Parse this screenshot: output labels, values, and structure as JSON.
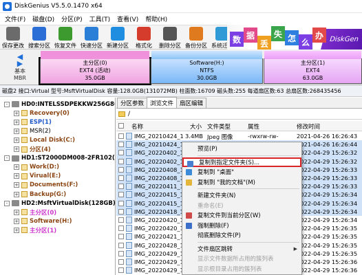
{
  "window": {
    "title": "DiskGenius V5.5.0.1470 x64"
  },
  "menu": [
    "文件(F)",
    "磁盘(D)",
    "分区(P)",
    "工具(T)",
    "查看(V)",
    "帮助(H)"
  ],
  "toolbar": [
    {
      "label": "保存更改",
      "icon": "save-icon",
      "color": "#6b6b6b"
    },
    {
      "label": "搜索分区",
      "icon": "search-icon",
      "color": "#2b6fd6"
    },
    {
      "label": "恢复文件",
      "icon": "restore-icon",
      "color": "#3c9a2f"
    },
    {
      "label": "快速分区",
      "icon": "quick-partition-icon",
      "color": "#2b7fd6"
    },
    {
      "label": "新建分区",
      "icon": "new-partition-icon",
      "color": "#1f8ee0"
    },
    {
      "label": "格式化",
      "icon": "format-icon",
      "color": "#d63c2b"
    },
    {
      "label": "删除分区",
      "icon": "delete-icon",
      "color": "#555555"
    },
    {
      "label": "备份分区",
      "icon": "backup-icon",
      "color": "#e07a1f"
    },
    {
      "label": "系统迁移",
      "icon": "migrate-icon",
      "color": "#2f9ad6"
    }
  ],
  "banner": {
    "chars": [
      {
        "t": "数",
        "c": "#7b3fe4"
      },
      {
        "t": "据",
        "c": "#e24a8a"
      },
      {
        "t": "丢",
        "c": "#f0a020"
      },
      {
        "t": "失",
        "c": "#3aa54a"
      },
      {
        "t": "怎",
        "c": "#2f7fe0"
      },
      {
        "t": "么",
        "c": "#7b3fe4"
      },
      {
        "t": "办",
        "c": "#e24a4a"
      }
    ],
    "brand": "DiskGen"
  },
  "diskmap": {
    "basic_line1": "基本",
    "basic_line2": "MBR",
    "partitions": [
      {
        "title": "主分区(0)",
        "fs": "EXT4 (活动)",
        "size": "35.0GB"
      },
      {
        "title": "Software(H:)",
        "fs": "NTFS",
        "size": "30.0GB"
      },
      {
        "title": "主分区(1)",
        "fs": "EXT4",
        "size": "63.0GB"
      }
    ]
  },
  "infobar": "磁盘2 接口:Virtual  型号:MsftVirtualDisk  容量:128.0GB(131072MB)  柱面数:16709  磁头数:255  每道扇区数:63  总扇区数:268435456",
  "tree": [
    {
      "label": "HD0:INTELSSDPEKKW256G8(238",
      "style": "b",
      "kind": "disk",
      "toggle": "-",
      "indent": 0
    },
    {
      "label": "Recovery(0)",
      "style": "brown",
      "kind": "part",
      "toggle": "+",
      "indent": 1
    },
    {
      "label": "ESP(1)",
      "style": "blue",
      "kind": "part",
      "toggle": "+",
      "indent": 1
    },
    {
      "label": "MSR(2)",
      "style": "",
      "kind": "part",
      "toggle": "+",
      "indent": 1
    },
    {
      "label": "Local Disk(C:)",
      "style": "brown",
      "kind": "part",
      "toggle": "+",
      "indent": 1
    },
    {
      "label": "分区(4)",
      "style": "brown",
      "kind": "part",
      "toggle": "+",
      "indent": 1
    },
    {
      "label": "HD1:ST2000DM008-2FR102(1863",
      "style": "b",
      "kind": "disk",
      "toggle": "-",
      "indent": 0
    },
    {
      "label": "Work(D:)",
      "style": "brown",
      "kind": "part",
      "toggle": "+",
      "indent": 1
    },
    {
      "label": "Virual(E:)",
      "style": "brown",
      "kind": "part",
      "toggle": "+",
      "indent": 1
    },
    {
      "label": "Documents(F:)",
      "style": "brown",
      "kind": "part",
      "toggle": "+",
      "indent": 1
    },
    {
      "label": "Backup(G:)",
      "style": "brown",
      "kind": "part",
      "toggle": "+",
      "indent": 1
    },
    {
      "label": "HD2:MsftVirtualDisk(128GB)",
      "style": "b",
      "kind": "disk",
      "toggle": "-",
      "indent": 0
    },
    {
      "label": "主分区(0)",
      "style": "pink",
      "kind": "part",
      "toggle": "+",
      "indent": 1
    },
    {
      "label": "Software(H:)",
      "style": "brown",
      "kind": "part",
      "toggle": "+",
      "indent": 1
    },
    {
      "label": "主分区(1)",
      "style": "pink",
      "kind": "part",
      "toggle": "+",
      "indent": 1
    }
  ],
  "tabs": [
    "分区参数",
    "浏览文件",
    "扇区编辑"
  ],
  "active_tab": 1,
  "path": "/",
  "columns": {
    "name": "名称",
    "size": "大小",
    "type": "文件类型",
    "attr": "属性",
    "mod": "修改时间"
  },
  "files": [
    {
      "name": "IMG_20210424_1",
      "size": "3.4MB",
      "type": "Jpeg 图像",
      "attr": "-rwxrw-rw-",
      "mod": "2021-04-26 16:26:43",
      "sel": false
    },
    {
      "name": "IMG_20210424_1",
      "size": "",
      "type": "",
      "attr": "",
      "mod": "2021-04-26 16:26:44",
      "sel": true
    },
    {
      "name": "IMG_20220402_1",
      "size": "",
      "type": "",
      "attr": "",
      "mod": "2022-04-29 15:26:32",
      "sel": true
    },
    {
      "name": "IMG_20220402_1",
      "size": "",
      "type": "",
      "attr": "",
      "mod": "2022-04-29 15:26:32",
      "sel": true
    },
    {
      "name": "IMG_20220408_1",
      "size": "",
      "type": "",
      "attr": "",
      "mod": "2022-04-29 15:26:33",
      "sel": true
    },
    {
      "name": "IMG_20220408_1",
      "size": "",
      "type": "",
      "attr": "",
      "mod": "2022-04-29 15:26:33",
      "sel": true
    },
    {
      "name": "IMG_20220411_1",
      "size": "",
      "type": "",
      "attr": "",
      "mod": "2022-04-29 15:26:33",
      "sel": true
    },
    {
      "name": "IMG_20220415_1",
      "size": "",
      "type": "",
      "attr": "",
      "mod": "2022-04-29 15:26:34",
      "sel": true
    },
    {
      "name": "IMG_20220415_1",
      "size": "",
      "type": "",
      "attr": "",
      "mod": "2022-04-29 15:26:34",
      "sel": true
    },
    {
      "name": "IMG_20220418_1",
      "size": "",
      "type": "",
      "attr": "",
      "mod": "2022-04-29 15:26:34",
      "sel": true
    },
    {
      "name": "IMG_20220420_1",
      "size": "",
      "type": "",
      "attr": "",
      "mod": "2022-04-29 15:26:34",
      "sel": false
    },
    {
      "name": "IMG_20220420_1",
      "size": "",
      "type": "",
      "attr": "",
      "mod": "2022-04-29 15:26:35",
      "sel": false
    },
    {
      "name": "IMG_20220421_1",
      "size": "",
      "type": "",
      "attr": "",
      "mod": "2022-04-29 15:26:35",
      "sel": false
    },
    {
      "name": "IMG_20220428_1",
      "size": "",
      "type": "",
      "attr": "",
      "mod": "2022-04-29 15:26:35",
      "sel": false
    },
    {
      "name": "IMG_20220429_1",
      "size": "",
      "type": "",
      "attr": "",
      "mod": "2022-04-29 15:26:35",
      "sel": false
    },
    {
      "name": "IMG_20220429_1",
      "size": "",
      "type": "",
      "attr": "",
      "mod": "2022-04-29 15:26:36",
      "sel": false
    },
    {
      "name": "IMG_20220429_1",
      "size": "",
      "type": "",
      "attr": "",
      "mod": "2022-04-29 15:26:36",
      "sel": false
    }
  ],
  "context_menu": [
    {
      "label": "预览(P)",
      "icon": "",
      "disabled": false,
      "highlight": false,
      "sub": false
    },
    {
      "sep": true
    },
    {
      "label": "复制到指定文件夹(S)...",
      "icon": "copy-folder-icon",
      "iconColor": "#4a7fd0",
      "disabled": false,
      "highlight": true,
      "sub": false
    },
    {
      "label": "复制到 \"桌面\"",
      "icon": "desktop-icon",
      "iconColor": "#3d8ad8",
      "disabled": false,
      "highlight": false,
      "sub": false
    },
    {
      "label": "复制到 \"我的文档\"(M)",
      "icon": "documents-icon",
      "iconColor": "#e3b53a",
      "disabled": false,
      "highlight": false,
      "sub": false
    },
    {
      "sep": true
    },
    {
      "label": "新建文件夹(N)",
      "icon": "",
      "disabled": false,
      "highlight": false,
      "sub": false
    },
    {
      "label": "重命名(E)",
      "icon": "",
      "disabled": true,
      "highlight": false,
      "sub": false
    },
    {
      "label": "复制文件到当前分区(W)",
      "icon": "copy-partition-icon",
      "iconColor": "#d04a4a",
      "disabled": false,
      "highlight": false,
      "sub": false
    },
    {
      "label": "强制删除(F)",
      "icon": "force-delete-icon",
      "iconColor": "#3b6fc9",
      "disabled": false,
      "highlight": false,
      "sub": false
    },
    {
      "label": "彻底删除文件(P)",
      "icon": "",
      "disabled": false,
      "highlight": false,
      "sub": false
    },
    {
      "sep": true
    },
    {
      "label": "文件扇区跳转",
      "icon": "",
      "disabled": false,
      "highlight": false,
      "sub": true
    },
    {
      "label": "显示文件数据所占用的簇列表",
      "icon": "",
      "disabled": true,
      "highlight": false,
      "sub": false
    },
    {
      "label": "显示根目录占用的簇列表",
      "icon": "",
      "disabled": true,
      "highlight": false,
      "sub": false
    }
  ]
}
